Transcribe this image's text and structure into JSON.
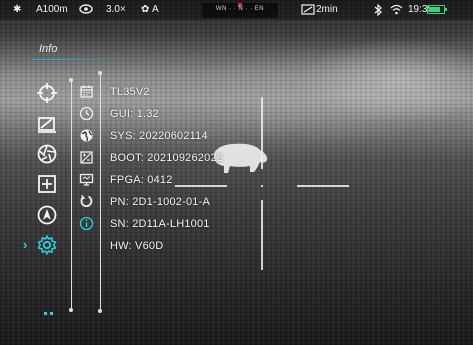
{
  "status_bar": {
    "star_icon": "star-icon",
    "altitude": "A100m",
    "eye_icon": "eye-icon",
    "zoom": "3.0×",
    "mode": "A",
    "compass_scale": "WN · · N · · EN",
    "timer": "2min",
    "time": "19:35",
    "battery_color": "#36d67a",
    "battery_level": 0.8
  },
  "page_title": "Info",
  "accent_color": "#2fd0e0",
  "sidebar": {
    "items": [
      {
        "icon": "crosshair-icon",
        "active": false
      },
      {
        "icon": "image-edit-icon",
        "active": false
      },
      {
        "icon": "aperture-icon",
        "active": false
      },
      {
        "icon": "plus-box-icon",
        "active": false
      },
      {
        "icon": "navigation-icon",
        "active": false
      },
      {
        "icon": "settings-gear-icon",
        "active": true
      }
    ]
  },
  "submenu_icons": [
    "calendar-icon",
    "clock-icon",
    "globe-icon",
    "image-adjust-icon",
    "display-icon",
    "reset-icon",
    "info-icon"
  ],
  "info_lines": [
    "TL35V2",
    "GUI: 1.32",
    "SYS: 20220602114",
    "BOOT: 202109262022",
    "FPGA: 0412",
    "PN: 2D1-1002-01-A",
    "SN: 2D11A-LH1001",
    "HW: V60D"
  ]
}
